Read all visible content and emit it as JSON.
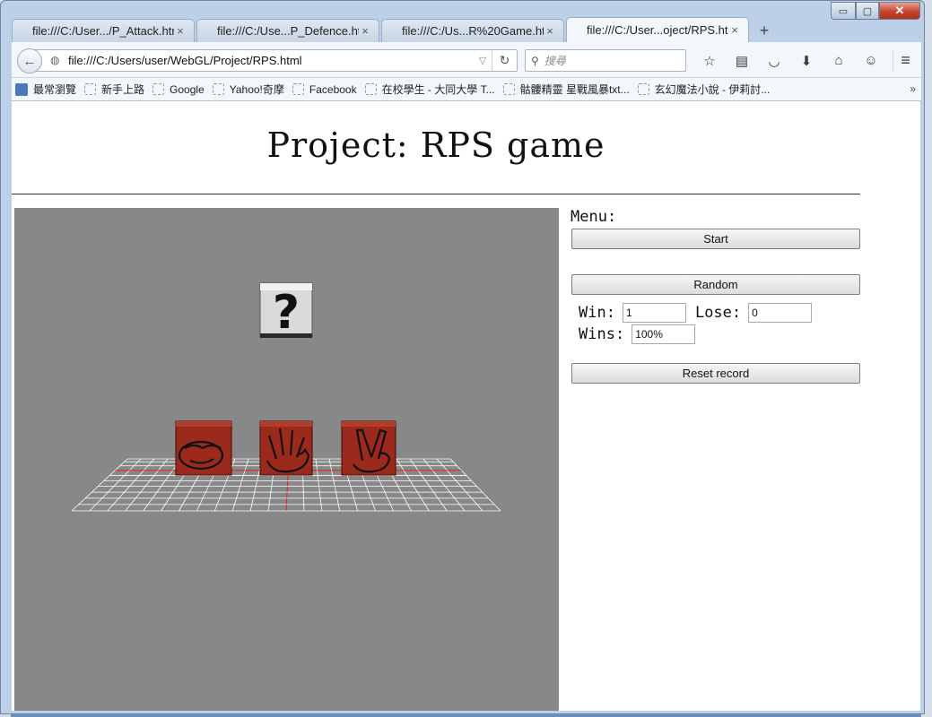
{
  "window": {
    "caption": {
      "minimize": "▭",
      "maximize": "▢",
      "close": "✕"
    }
  },
  "tabs": [
    {
      "label": "file:///C:/User.../P_Attack.html",
      "close": "×"
    },
    {
      "label": "file:///C:/Use...P_Defence.html",
      "close": "×"
    },
    {
      "label": "file:///C:/Us...R%20Game.html",
      "close": "×"
    },
    {
      "label": "file:///C:/User...oject/RPS.html",
      "close": "×",
      "active": true
    }
  ],
  "new_tab": "+",
  "nav": {
    "url": "file:///C:/Users/user/WebGL/Project/RPS.html",
    "search_placeholder": "搜尋",
    "icons": [
      "star-icon",
      "reader-icon",
      "pocket-icon",
      "download-icon",
      "home-icon",
      "smiley-icon"
    ]
  },
  "bookmarks": [
    "最常瀏覽",
    "新手上路",
    "Google",
    "Yahoo!奇摩",
    "Facebook",
    "在校學生 - 大同大學 T...",
    "骷髏精靈 星戰風暴txt...",
    "玄幻魔法小說 - 伊莉討..."
  ],
  "bookmarks_overflow": "»",
  "page": {
    "title": "Project: RPS game",
    "menu_label": "Menu:",
    "start_label": "Start",
    "random_label": "Random",
    "win_label": "Win:",
    "win_value": "1",
    "lose_label": "Lose:",
    "lose_value": "0",
    "wins_label": "Wins:",
    "wins_value": "100%",
    "reset_label": "Reset record",
    "mystery_symbol": "?"
  },
  "colors": {
    "scene_bg": "#888888",
    "cube_red": "#9b2a1c",
    "grid_line": "#ffffff",
    "axis_line": "#ff0000"
  }
}
